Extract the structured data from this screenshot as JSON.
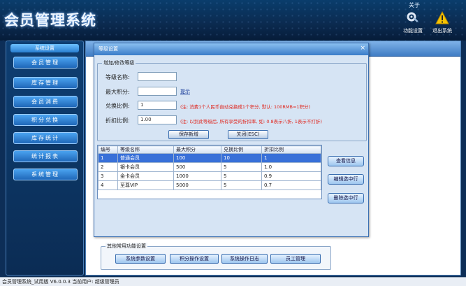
{
  "app": {
    "title": "会员管理系统",
    "top_link": "关于",
    "tools": [
      {
        "label": "功能设置",
        "icon": "gear-icon"
      },
      {
        "label": "退出系统",
        "icon": "warning-icon"
      }
    ]
  },
  "sidebar": {
    "header": "系统设置",
    "items": [
      "会员管理",
      "库存管理",
      "会员消费",
      "积分兑换",
      "库存统计",
      "统计报表",
      "系统管理"
    ]
  },
  "dialog": {
    "title": "等级设置",
    "close": "×",
    "legend": "增加/修改等级",
    "fields": [
      {
        "label": "等级名称:",
        "value": "",
        "note": ""
      },
      {
        "label": "最大积分:",
        "value": "",
        "link": "提示"
      },
      {
        "label": "兑换比例:",
        "value": "1",
        "note": "(注: 消费1个人民币自动兑换成1个积分, 默认: 100RMB=1积分)"
      },
      {
        "label": "折扣比例:",
        "value": "1.00",
        "note": "(注: 以到此等级后, 所有享受的折扣率, 如: 0.8表示八折, 1表示不打折)"
      }
    ],
    "buttons": {
      "save": "保存新增",
      "close": "关闭(ESC)"
    },
    "table": {
      "columns": [
        "编号",
        "等级名称",
        "最大积分",
        "兑换比例",
        "折扣比例"
      ],
      "rows": [
        [
          "1",
          "普通会员",
          "100",
          "10",
          "1"
        ],
        [
          "2",
          "银卡会员",
          "500",
          "5",
          "1.0"
        ],
        [
          "3",
          "金卡会员",
          "1000",
          "5",
          "0.9"
        ],
        [
          "4",
          "至尊VIP",
          "5000",
          "5",
          "0.7"
        ]
      ],
      "selected_row": 0
    },
    "side_buttons": [
      "查看信息",
      "编辑选中行",
      "删除选中行"
    ]
  },
  "other": {
    "legend": "其他常用功能设置",
    "buttons": [
      "系统参数设置",
      "积分操作设置",
      "系统操作日志",
      "员工管理"
    ]
  },
  "status": "会员管理系统_试用版 V6.0.0.3 当前用户: 超级管理员"
}
